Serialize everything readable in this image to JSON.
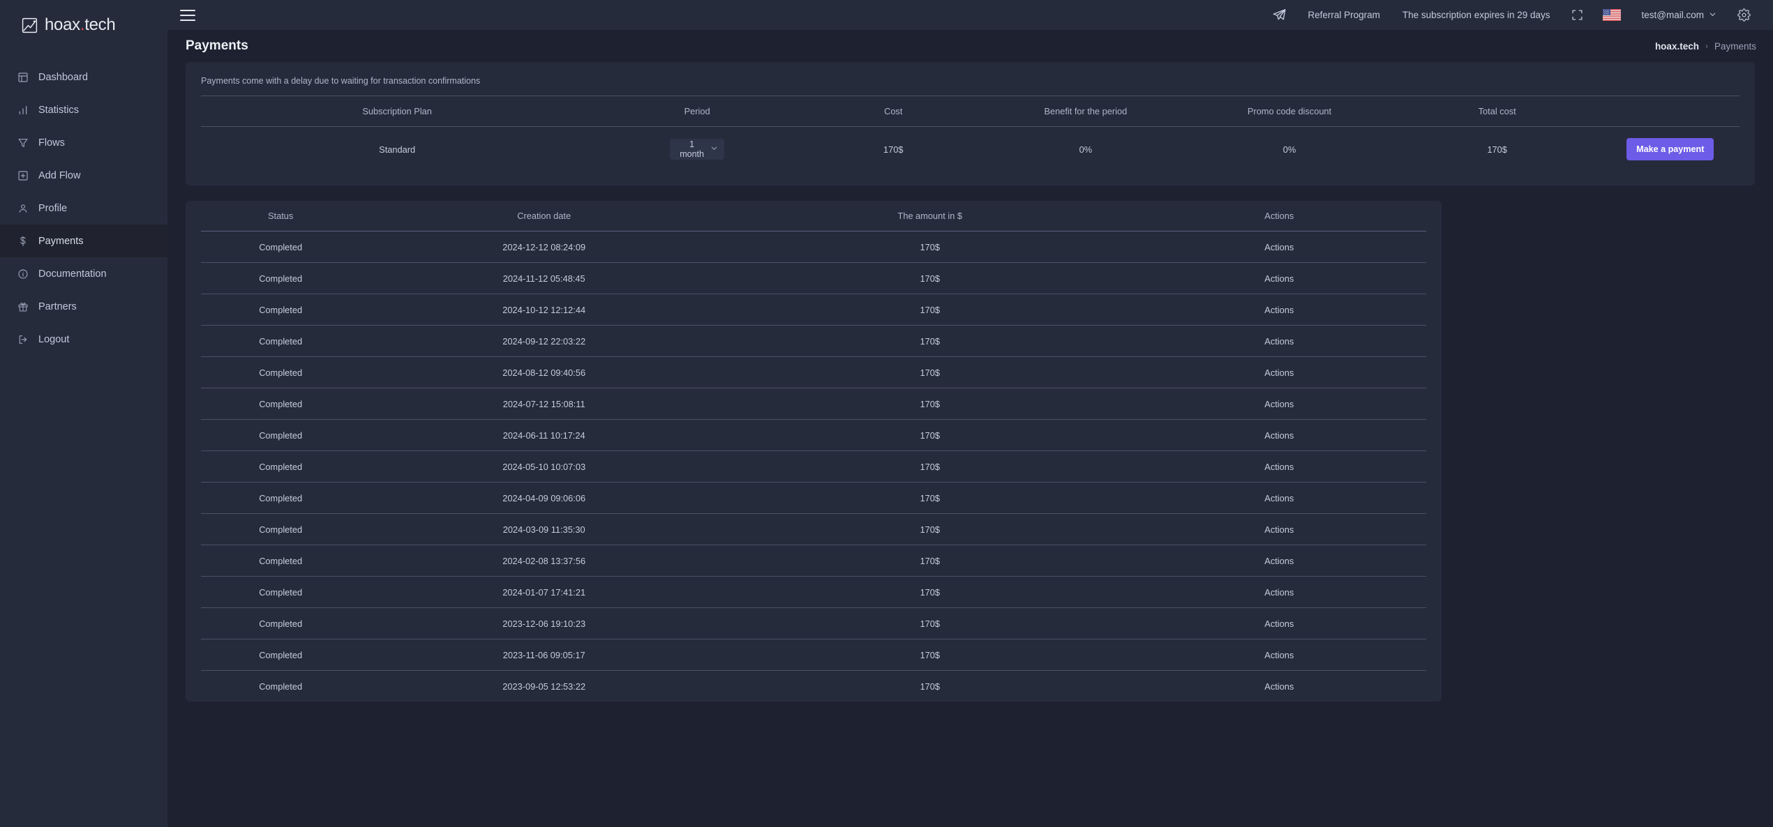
{
  "brand": {
    "name_main": "hoax",
    "dot": ".",
    "name_tld": "tech"
  },
  "sidebar": {
    "items": [
      {
        "label": "Dashboard",
        "icon": "dashboard-icon",
        "active": false
      },
      {
        "label": "Statistics",
        "icon": "bar-chart-icon",
        "active": false
      },
      {
        "label": "Flows",
        "icon": "funnel-icon",
        "active": false
      },
      {
        "label": "Add Flow",
        "icon": "plus-square-icon",
        "active": false
      },
      {
        "label": "Profile",
        "icon": "user-icon",
        "active": false
      },
      {
        "label": "Payments",
        "icon": "dollar-icon",
        "active": true
      },
      {
        "label": "Documentation",
        "icon": "info-circle-icon",
        "active": false
      },
      {
        "label": "Partners",
        "icon": "gift-icon",
        "active": false
      },
      {
        "label": "Logout",
        "icon": "logout-icon",
        "active": false
      }
    ]
  },
  "topbar": {
    "menu_icon": "hamburger-icon",
    "telegram_icon": "telegram-send-icon",
    "referral_label": "Referral Program",
    "subscription_notice": "The subscription expires in 29 days",
    "fullscreen_icon": "fullscreen-icon",
    "language_icon": "us-flag-icon",
    "account_email": "test@mail.com",
    "account_caret": "chevron-down-icon",
    "settings_icon": "gear-icon"
  },
  "page": {
    "title": "Payments",
    "breadcrumb_root": "hoax.tech",
    "breadcrumb_sep": "›",
    "breadcrumb_current": "Payments"
  },
  "subscription_card": {
    "notice": "Payments come with a delay due to waiting for transaction confirmations",
    "headers": [
      "",
      "Subscription Plan",
      "Period",
      "Cost",
      "Benefit for the period",
      "Promo code discount",
      "Total cost",
      ""
    ],
    "row": {
      "plan": "Standard",
      "period_value": "1 month",
      "period_options": [
        "1 month"
      ],
      "cost": "170$",
      "benefit": "0%",
      "promo_discount": "0%",
      "total_cost": "170$",
      "action_label": "Make a payment"
    }
  },
  "history_card": {
    "headers": [
      "Status",
      "Creation date",
      "The amount in $",
      "Actions"
    ],
    "rows": [
      {
        "status": "Completed",
        "created": "2024-12-12 08:24:09",
        "amount": "170$",
        "actions": "Actions"
      },
      {
        "status": "Completed",
        "created": "2024-11-12 05:48:45",
        "amount": "170$",
        "actions": "Actions"
      },
      {
        "status": "Completed",
        "created": "2024-10-12 12:12:44",
        "amount": "170$",
        "actions": "Actions"
      },
      {
        "status": "Completed",
        "created": "2024-09-12 22:03:22",
        "amount": "170$",
        "actions": "Actions"
      },
      {
        "status": "Completed",
        "created": "2024-08-12 09:40:56",
        "amount": "170$",
        "actions": "Actions"
      },
      {
        "status": "Completed",
        "created": "2024-07-12 15:08:11",
        "amount": "170$",
        "actions": "Actions"
      },
      {
        "status": "Completed",
        "created": "2024-06-11 10:17:24",
        "amount": "170$",
        "actions": "Actions"
      },
      {
        "status": "Completed",
        "created": "2024-05-10 10:07:03",
        "amount": "170$",
        "actions": "Actions"
      },
      {
        "status": "Completed",
        "created": "2024-04-09 09:06:06",
        "amount": "170$",
        "actions": "Actions"
      },
      {
        "status": "Completed",
        "created": "2024-03-09 11:35:30",
        "amount": "170$",
        "actions": "Actions"
      },
      {
        "status": "Completed",
        "created": "2024-02-08 13:37:56",
        "amount": "170$",
        "actions": "Actions"
      },
      {
        "status": "Completed",
        "created": "2024-01-07 17:41:21",
        "amount": "170$",
        "actions": "Actions"
      },
      {
        "status": "Completed",
        "created": "2023-12-06 19:10:23",
        "amount": "170$",
        "actions": "Actions"
      },
      {
        "status": "Completed",
        "created": "2023-11-06 09:05:17",
        "amount": "170$",
        "actions": "Actions"
      },
      {
        "status": "Completed",
        "created": "2023-09-05 12:53:22",
        "amount": "170$",
        "actions": "Actions"
      }
    ]
  },
  "colors": {
    "page_bg": "#1e2130",
    "panel_bg": "#262b3c",
    "sidebar_active_bg": "#20232f",
    "accent": "#6c5ce7",
    "brand_dot": "#e0514f",
    "text_primary": "#e8eaf0",
    "text_muted": "#aeb6c8",
    "divider": "#4a5265"
  }
}
